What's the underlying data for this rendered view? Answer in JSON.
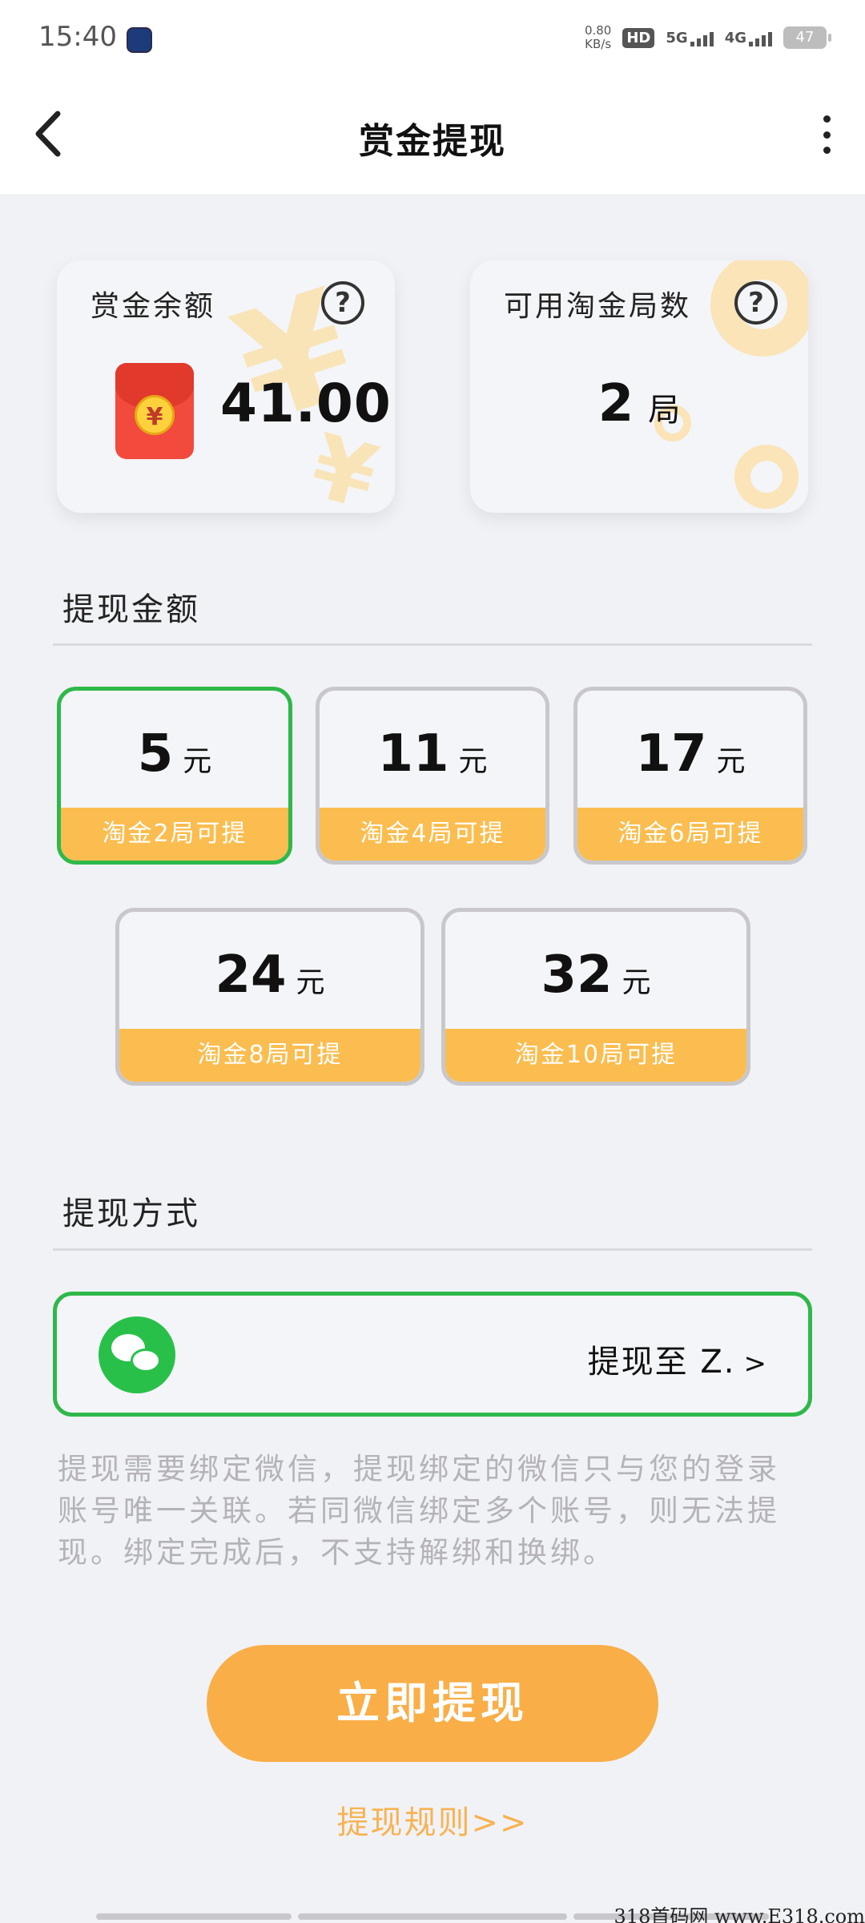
{
  "status_bar": {
    "time": "15:40",
    "net_speed_value": "0.80",
    "net_speed_unit": "KB/s",
    "hd_label": "HD",
    "signal_5g": "5G",
    "signal_4g": "4G",
    "battery": "47"
  },
  "nav": {
    "title": "赏金提现"
  },
  "balance_card": {
    "label": "赏金余额",
    "help": "?",
    "coin_symbol": "¥",
    "value": "41.00"
  },
  "rounds_card": {
    "label": "可用淘金局数",
    "help": "?",
    "value": "2",
    "unit": "局"
  },
  "amount_section": {
    "title": "提现金额",
    "options": [
      {
        "amount": "5",
        "unit": "元",
        "tag": "淘金2局可提",
        "selected": true
      },
      {
        "amount": "11",
        "unit": "元",
        "tag": "淘金4局可提",
        "selected": false
      },
      {
        "amount": "17",
        "unit": "元",
        "tag": "淘金6局可提",
        "selected": false
      },
      {
        "amount": "24",
        "unit": "元",
        "tag": "淘金8局可提",
        "selected": false
      },
      {
        "amount": "32",
        "unit": "元",
        "tag": "淘金10局可提",
        "selected": false
      }
    ]
  },
  "method_section": {
    "title": "提现方式",
    "target_text": "提现至 Z.",
    "arrow": ">"
  },
  "notice": "提现需要绑定微信，提现绑定的微信只与您的登录账号唯一关联。若同微信绑定多个账号，则无法提现。绑定完成后，不支持解绑和换绑。",
  "actions": {
    "withdraw_button": "立即提现",
    "rules_link": "提现规则>>"
  },
  "watermark": "318首码网 www.E318.com",
  "colors": {
    "accent_green": "#2fb84a",
    "tag_orange": "#fbbd4f",
    "button_orange": "#f9ae48",
    "link_orange": "#f7b352"
  }
}
